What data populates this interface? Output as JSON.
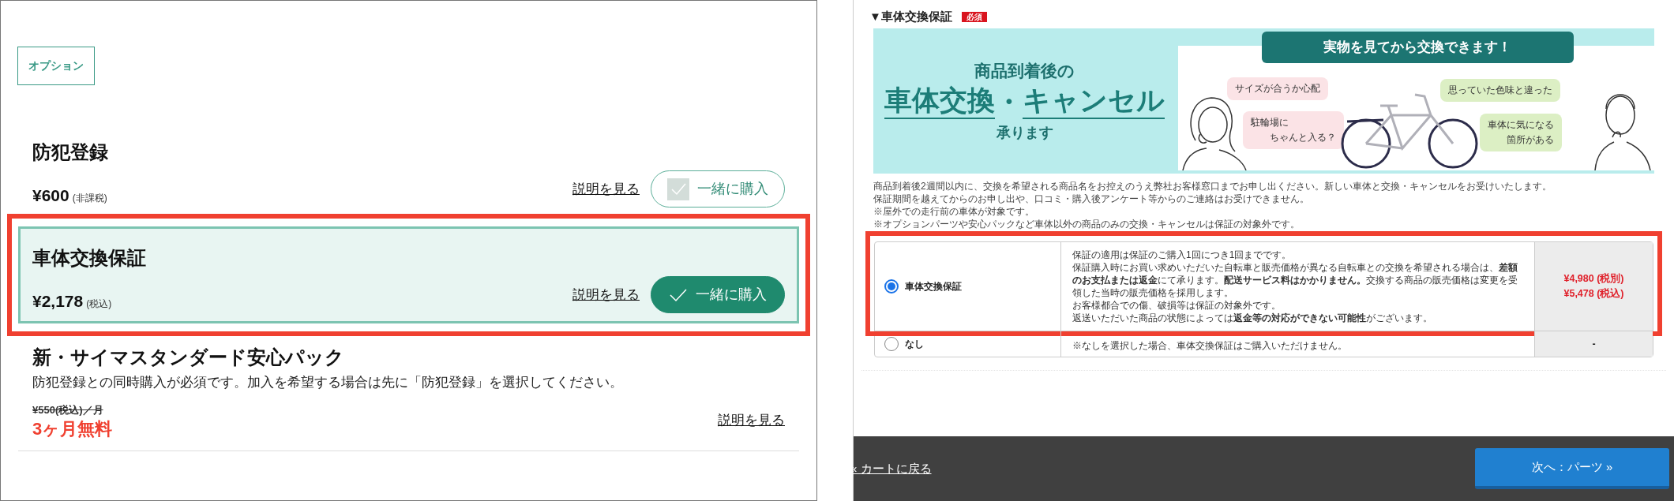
{
  "options_panel": {
    "tag": "オプション",
    "items": [
      {
        "title": "防犯登録",
        "price": "¥600",
        "tax_note": "(非課税)",
        "link": "説明を見る",
        "button": {
          "label": "一緒に購入",
          "checked": false
        },
        "selected": false,
        "highlighted": false
      },
      {
        "title": "車体交換保証",
        "price": "¥2,178",
        "tax_note": "(税込)",
        "link": "説明を見る",
        "button": {
          "label": "一緒に購入",
          "checked": true
        },
        "selected": true,
        "highlighted": true
      },
      {
        "title": "新・サイマスタンダード安心パック",
        "description": "防犯登録との同時購入が必須です。加入を希望する場合は先に「防犯登録」を選択してください。",
        "old_price": "¥550(税込)／月",
        "promo": "3ヶ月無料",
        "link": "説明を見る",
        "selected": false,
        "highlighted": false
      }
    ]
  },
  "warranty_panel": {
    "section_title": "▼車体交換保証",
    "required_badge": "必須",
    "banner": {
      "headline_top": "商品到着後の",
      "headline_parts": [
        {
          "text": "車体交換",
          "underlined": true
        },
        {
          "text": "・",
          "underlined": false
        },
        {
          "text": "キャンセル",
          "underlined": true
        }
      ],
      "headline_bottom": "承ります",
      "pill": "実物を見てから交換できます！",
      "bubbles": [
        {
          "lines": [
            "サイズが合うか心配"
          ],
          "color": "#fbe3e6"
        },
        {
          "lines": [
            "駐輪場に",
            "ちゃんと入る？"
          ],
          "color": "#fbe3e6"
        },
        {
          "lines": [
            "思っていた色味と違った"
          ],
          "color": "#dcefc4"
        },
        {
          "lines": [
            "車体に気になる",
            "箇所がある"
          ],
          "color": "#dcefc4"
        }
      ]
    },
    "notes": [
      "商品到着後2週間以内に、交換を希望される商品名をお控えのうえ弊社お客様窓口までお申し出ください。新しい車体と交換・キャンセルをお受けいたします。",
      "保証期間を越えてからのお申し出や、口コミ・購入後アンケート等からのご連絡はお受けできません。",
      "※屋外での走行前の車体が対象です。",
      "※オプションパーツや安心パックなど車体以外の商品のみの交換・キャンセルは保証の対象外です。"
    ],
    "table": {
      "rows": [
        {
          "label": "車体交換保証",
          "selected": true,
          "highlighted": true,
          "description": [
            "保証の適用は保証のご購入1回につき1回までです。",
            "保証購入時にお買い求めいただいた自転車と販売価格が異なる自転車との交換を希望される場合は、**差額のお支払または返金**にて承ります。**配送サービス料はかかりません。**交換する商品の販売価格は変更を受領した当時の販売価格を採用します。",
            "お客様都合での傷、破損等は保証の対象外です。",
            "返送いただいた商品の状態によっては**返金等の対応ができない可能性**がございます。"
          ],
          "price_lines": [
            "¥4,980 (税別)",
            "¥5,478 (税込)"
          ]
        },
        {
          "label": "なし",
          "selected": false,
          "highlighted": false,
          "description": [
            "※なしを選択した場合、車体交換保証はご購入いただけません。"
          ],
          "price_lines": [
            "-"
          ]
        }
      ]
    },
    "footer": {
      "back_link": "« カートに戻る",
      "next_button": "次へ：パーツ »"
    }
  }
}
